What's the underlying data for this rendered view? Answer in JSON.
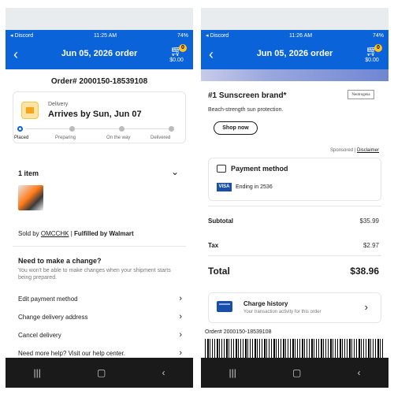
{
  "left": {
    "status_bar": {
      "carrier": "◂ Discord",
      "time": "11:25 AM",
      "battery": "74%"
    },
    "header": {
      "title": "Jun 05, 2026 order",
      "cart_count": "0",
      "cart_total": "$0.00"
    },
    "order_number": "Order# 2000150-18539108",
    "delivery": {
      "label": "Delivery",
      "arrival": "Arrives by Sun, Jun 07",
      "steps": [
        "Placed",
        "Preparing",
        "On the way",
        "Delivered"
      ],
      "active_step": 0
    },
    "items": {
      "heading": "1 item"
    },
    "seller": {
      "prefix": "Sold by ",
      "name": "OMCCHK",
      "separator": " | ",
      "fulfilled": "Fulfilled by Walmart"
    },
    "change": {
      "heading": "Need to make a change?",
      "note": "You won't be able to make changes when your shipment starts being prepared.",
      "actions": [
        {
          "label": "Edit payment method"
        },
        {
          "label": "Change delivery address"
        },
        {
          "label": "Cancel delivery"
        },
        {
          "label": "Need more help? Visit our help center."
        }
      ]
    },
    "bottom_nav": [
      "|||",
      "▢",
      "‹"
    ]
  },
  "right": {
    "status_bar": {
      "carrier": "◂ Discord",
      "time": "11:26 AM",
      "battery": "74%"
    },
    "header": {
      "title": "Jun 05, 2026 order",
      "cart_count": "0",
      "cart_total": "$0.00"
    },
    "ad": {
      "headline": "#1 Sunscreen brand*",
      "brand": "Neutrogena",
      "subline": "Beach-strength sun protection.",
      "button": "Shop now",
      "sponsored": "Sponsored",
      "separator": " | ",
      "disclaimer": "Disclaimer"
    },
    "payment": {
      "title": "Payment method",
      "card_brand": "VISA",
      "ending": "Ending in 2536"
    },
    "summary": {
      "subtotal_label": "Subtotal",
      "subtotal": "$35.99",
      "tax_label": "Tax",
      "tax": "$2.97",
      "total_label": "Total",
      "total": "$38.96"
    },
    "charge_history": {
      "title": "Charge history",
      "subtitle": "Your transaction activity for this order"
    },
    "order_number": "Order# 2000150-18539108",
    "bottom_nav": [
      "|||",
      "▢",
      "‹"
    ]
  },
  "colors": {
    "walmart_blue": "#0a63d8",
    "spark_yellow": "#ffc220"
  },
  "icons": [
    "back-arrow-icon",
    "cart-icon",
    "box-icon",
    "chevron-down-icon",
    "chevron-right-icon",
    "credit-card-icon",
    "charge-history-icon"
  ]
}
